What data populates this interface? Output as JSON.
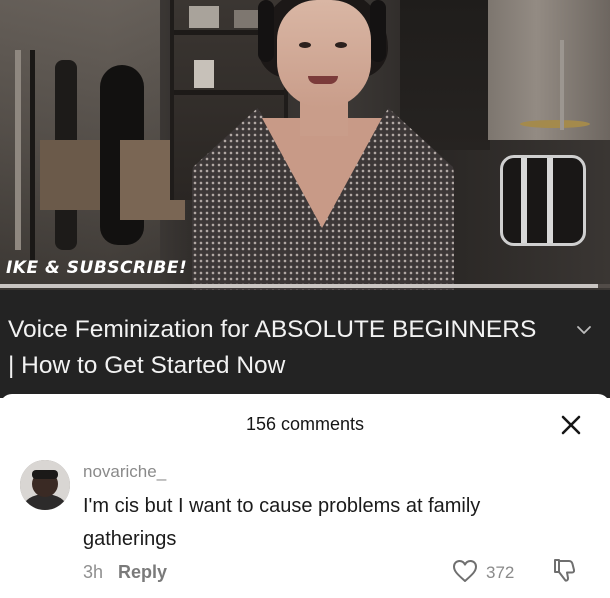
{
  "video": {
    "overlay_text": "IKE & SUBSCRIBE!",
    "progress": 0.98
  },
  "title_bar": {
    "title": "Voice Feminization for ABSOLUTE BEGINNERS | How to Get Started Now",
    "expand_icon": "chevron-down-icon"
  },
  "comments": {
    "count_label": "156 comments",
    "close_icon": "close-icon",
    "items": [
      {
        "username": "novariche_",
        "text": "I'm cis but I want to cause problems at family gatherings",
        "time": "3h",
        "reply_label": "Reply",
        "likes": "372",
        "like_icon": "heart-icon",
        "dislike_icon": "dislike-icon"
      }
    ]
  },
  "colors": {
    "title_bar_bg": "#232323",
    "sheet_bg": "#ffffff",
    "muted_text": "#8a8a8a"
  }
}
